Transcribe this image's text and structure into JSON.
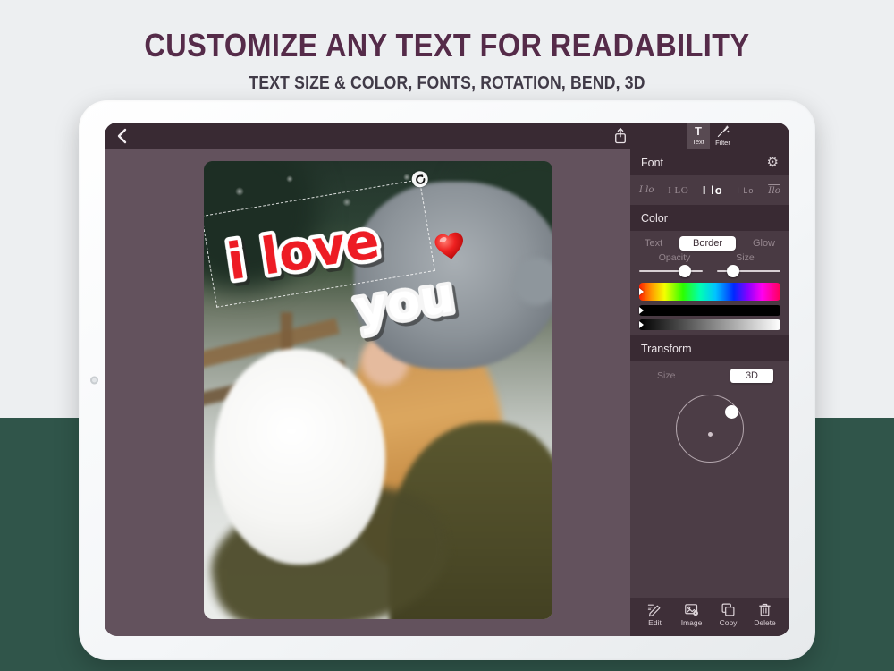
{
  "header": {
    "title": "CUSTOMIZE ANY TEXT FOR READABILITY",
    "subtitle": "TEXT SIZE & COLOR, FONTS, ROTATION, BEND, 3D"
  },
  "toolbar": {
    "back_icon": "chevron-left",
    "share_icon": "share-up-arrow",
    "tabs": [
      {
        "label": "Text",
        "icon": "T",
        "selected": true
      },
      {
        "label": "Filter",
        "icon": "magic-wand",
        "selected": false
      }
    ]
  },
  "editor": {
    "overlay": {
      "line1": "i love",
      "line2": "you",
      "sticker": "red-heart"
    }
  },
  "font_panel": {
    "title": "Font",
    "settings_icon": "gear",
    "samples": [
      "I lo",
      "I LO",
      "I lo",
      "I Lo",
      "Ilo"
    ],
    "selected_index": 2
  },
  "color_panel": {
    "title": "Color",
    "tabs": [
      "Text",
      "Border",
      "Glow"
    ],
    "selected_tab": "Border",
    "opacity_label": "Opacity",
    "opacity_value": 72,
    "size_label": "Size",
    "size_value": 25,
    "bars": [
      "hue-spectrum",
      "solid-black",
      "grayscale-gradient"
    ]
  },
  "transform_panel": {
    "title": "Transform",
    "size_label": "Size",
    "mode_label": "3D"
  },
  "actions": [
    {
      "label": "Edit",
      "icon": "pencil"
    },
    {
      "label": "Image",
      "icon": "picture"
    },
    {
      "label": "Copy",
      "icon": "duplicate"
    },
    {
      "label": "Delete",
      "icon": "trash"
    }
  ],
  "colors": {
    "headline": "#552b49",
    "background_top": "#edeff1",
    "background_bottom": "#30554a",
    "toolbar": "#392a33",
    "panel": "#4b3c45",
    "canvas": "#63525d",
    "accent_red": "#ed1c24"
  }
}
